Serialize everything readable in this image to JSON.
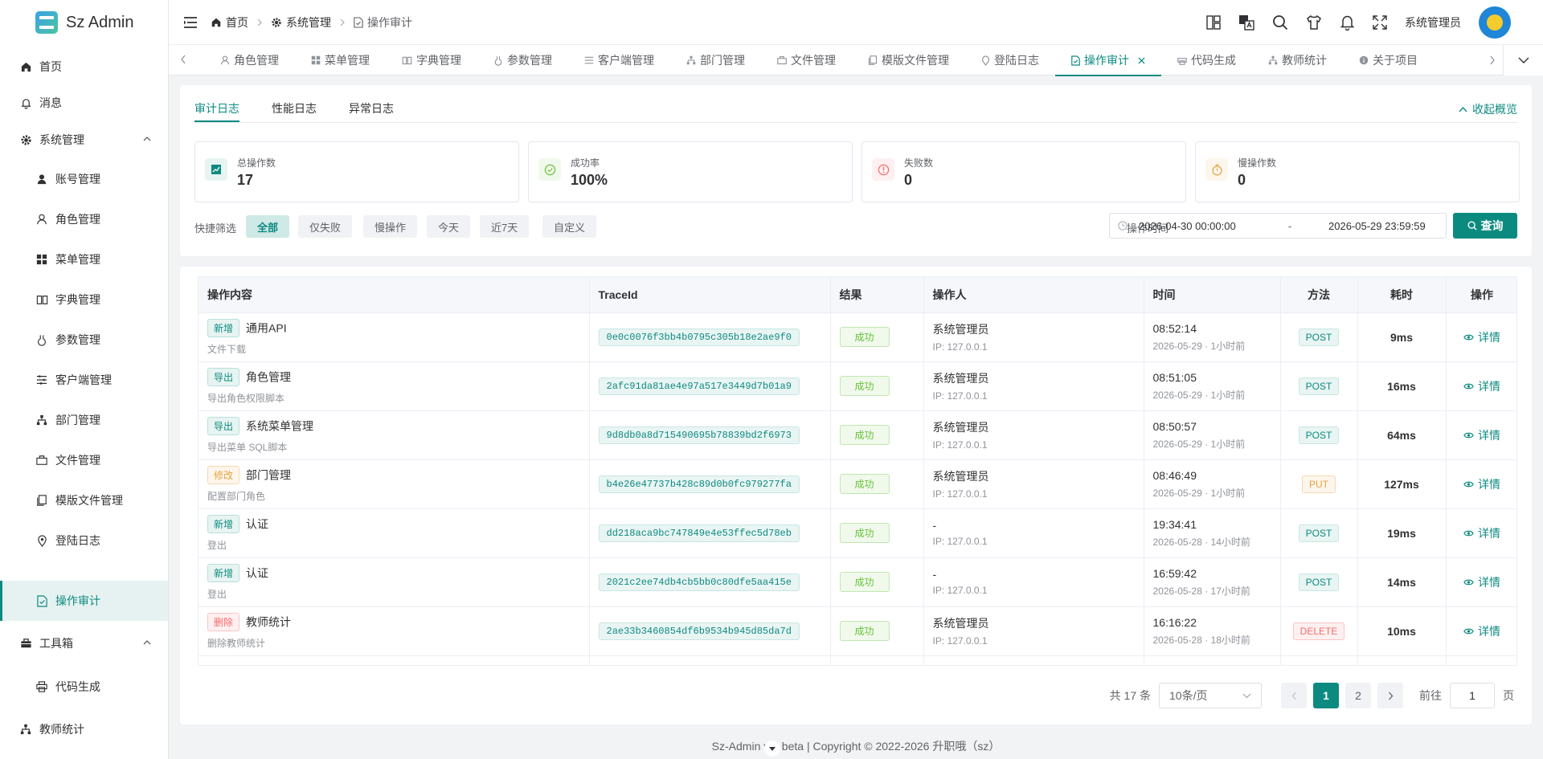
{
  "app": {
    "name": "Sz Admin"
  },
  "sidebar": {
    "items": [
      {
        "label": "首页"
      },
      {
        "label": "消息"
      },
      {
        "label": "系统管理"
      },
      {
        "label": "账号管理"
      },
      {
        "label": "角色管理"
      },
      {
        "label": "菜单管理"
      },
      {
        "label": "字典管理"
      },
      {
        "label": "参数管理"
      },
      {
        "label": "客户端管理"
      },
      {
        "label": "部门管理"
      },
      {
        "label": "文件管理"
      },
      {
        "label": "模版文件管理"
      },
      {
        "label": "登陆日志"
      },
      {
        "label": "操作审计"
      },
      {
        "label": "工具箱"
      },
      {
        "label": "代码生成"
      },
      {
        "label": "教师统计"
      }
    ]
  },
  "header": {
    "breadcrumb": [
      "首页",
      "系统管理",
      "操作审计"
    ],
    "user": "系统管理员"
  },
  "tabs": [
    "角色管理",
    "菜单管理",
    "字典管理",
    "参数管理",
    "客户端管理",
    "部门管理",
    "文件管理",
    "模版文件管理",
    "登陆日志",
    "操作审计",
    "代码生成",
    "教师统计",
    "关于项目"
  ],
  "log_tabs": [
    "审计日志",
    "性能日志",
    "异常日志"
  ],
  "collapse_label": "收起概览",
  "stats": [
    {
      "label": "总操作数",
      "value": "17"
    },
    {
      "label": "成功率",
      "value": "100%"
    },
    {
      "label": "失败数",
      "value": "0"
    },
    {
      "label": "慢操作数",
      "value": "0"
    }
  ],
  "filter": {
    "label": "快捷筛选",
    "chips": [
      "全部",
      "仅失败",
      "慢操作",
      "今天",
      "近7天",
      "自定义"
    ],
    "time_label": "操作时间",
    "start": "2026-04-30 00:00:00",
    "separator": "-",
    "end": "2026-05-29 23:59:59",
    "query": "查询"
  },
  "table": {
    "columns": [
      "操作内容",
      "TraceId",
      "结果",
      "操作人",
      "时间",
      "方法",
      "耗时",
      "操作"
    ],
    "rows": [
      {
        "tag": "新增",
        "name": "通用API",
        "sub": "文件下载",
        "trace": "0e0c0076f3bb4b0795c305b18e2ae9f0",
        "result": "成功",
        "user": "系统管理员",
        "ip": "IP: 127.0.0.1",
        "time": "08:52:14",
        "date": "2026-05-29 · 1小时前",
        "method": "POST",
        "duration": "9ms",
        "action": "详情"
      },
      {
        "tag": "导出",
        "name": "角色管理",
        "sub": "导出角色权限脚本",
        "trace": "2afc91da81ae4e97a517e3449d7b01a9",
        "result": "成功",
        "user": "系统管理员",
        "ip": "IP: 127.0.0.1",
        "time": "08:51:05",
        "date": "2026-05-29 · 1小时前",
        "method": "POST",
        "duration": "16ms",
        "action": "详情"
      },
      {
        "tag": "导出",
        "name": "系统菜单管理",
        "sub": "导出菜单 SQL脚本",
        "trace": "9d8db0a8d715490695b78839bd2f6973",
        "result": "成功",
        "user": "系统管理员",
        "ip": "IP: 127.0.0.1",
        "time": "08:50:57",
        "date": "2026-05-29 · 1小时前",
        "method": "POST",
        "duration": "64ms",
        "action": "详情"
      },
      {
        "tag": "修改",
        "name": "部门管理",
        "sub": "配置部门角色",
        "trace": "b4e26e47737b428c89d0b0fc979277fa",
        "result": "成功",
        "user": "系统管理员",
        "ip": "IP: 127.0.0.1",
        "time": "08:46:49",
        "date": "2026-05-29 · 1小时前",
        "method": "PUT",
        "duration": "127ms",
        "action": "详情"
      },
      {
        "tag": "新增",
        "name": "认证",
        "sub": "登出",
        "trace": "dd218aca9bc747849e4e53ffec5d78eb",
        "result": "成功",
        "user": "-",
        "ip": "IP: 127.0.0.1",
        "time": "19:34:41",
        "date": "2026-05-28 · 14小时前",
        "method": "POST",
        "duration": "19ms",
        "action": "详情"
      },
      {
        "tag": "新增",
        "name": "认证",
        "sub": "登出",
        "trace": "2021c2ee74db4cb5bb0c80dfe5aa415e",
        "result": "成功",
        "user": "-",
        "ip": "IP: 127.0.0.1",
        "time": "16:59:42",
        "date": "2026-05-28 · 17小时前",
        "method": "POST",
        "duration": "14ms",
        "action": "详情"
      },
      {
        "tag": "删除",
        "name": "教师统计",
        "sub": "删除教师统计",
        "trace": "2ae33b3460854df6b9534b945d85da7d",
        "result": "成功",
        "user": "系统管理员",
        "ip": "IP: 127.0.0.1",
        "time": "16:16:22",
        "date": "2026-05-28 · 18小时前",
        "method": "DELETE",
        "duration": "10ms",
        "action": "详情"
      }
    ]
  },
  "pagination": {
    "total": "共 17 条",
    "page_size": "10条/页",
    "pages": [
      "1",
      "2"
    ],
    "goto_label": "前往",
    "goto_value": "1",
    "page_unit": "页"
  },
  "footer": "Sz-Admin v1.  beta | Copyright © 2022-2026 升职哦（sz）",
  "colors": {
    "primary": "#0d8a80",
    "success": "#67c23a",
    "warning": "#e6a23c",
    "danger": "#f56c6c"
  }
}
